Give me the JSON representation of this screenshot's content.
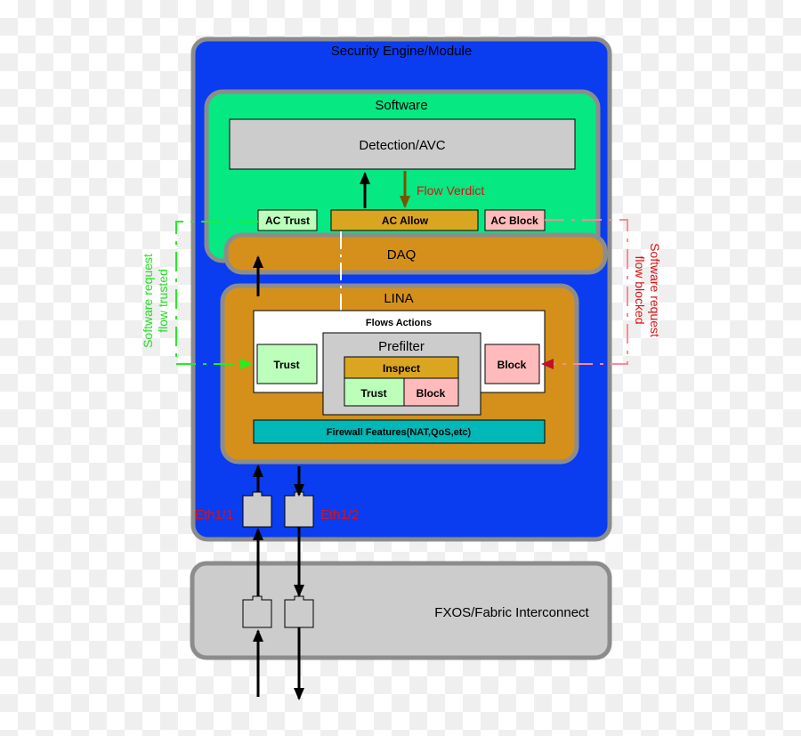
{
  "colors": {
    "engine": "#0a3cf0",
    "software": "#05e882",
    "daq": "#d4901a",
    "detection": "#cccccc",
    "trust": "#bbffbb",
    "allow": "#daa520",
    "block": "#ffbbbb",
    "firewall": "#00b8b8",
    "fxos": "#cccccc",
    "trusted_path": "#22dd22",
    "blocked_path": "#dd1111",
    "verdict": "#dd1111"
  },
  "engine": {
    "title": "Security Engine/Module"
  },
  "software": {
    "title": "Software",
    "detection": "Detection/AVC",
    "flow_verdict": "Flow Verdict",
    "ac_trust": "AC Trust",
    "ac_allow": "AC Allow",
    "ac_block": "AC Block"
  },
  "daq": {
    "title": "DAQ"
  },
  "lina": {
    "title": "LINA",
    "flows_actions": "Flows Actions",
    "trust": "Trust",
    "block": "Block",
    "prefilter": {
      "title": "Prefilter",
      "inspect": "Inspect",
      "trust": "Trust",
      "block": "Block"
    },
    "firewall": "Firewall Features(NAT,QoS,etc)"
  },
  "ports": {
    "eth1": "Eth1/1",
    "eth2": "Eth1/2"
  },
  "fxos": {
    "title": "FXOS/Fabric Interconnect"
  },
  "side": {
    "trusted_line1": "Software request",
    "trusted_line2": "flow trusted",
    "blocked_line1": "Software request",
    "blocked_line2": "flow blocked"
  }
}
